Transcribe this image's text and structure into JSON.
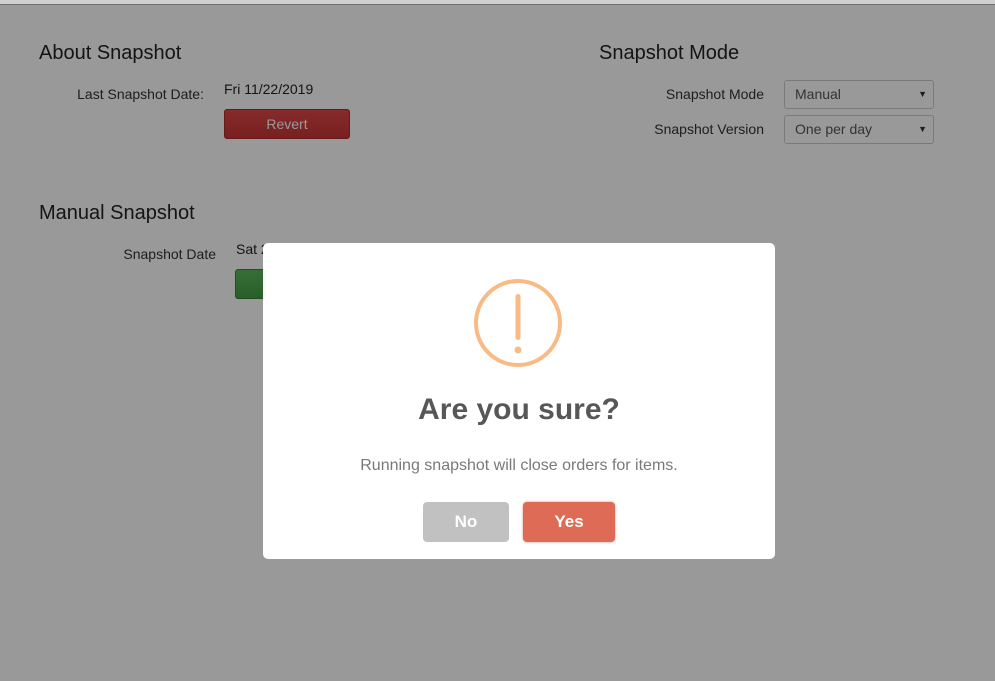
{
  "about": {
    "title": "About Snapshot",
    "last_date_label": "Last Snapshot Date:",
    "last_date_value": "Fri 11/22/2019",
    "revert_label": "Revert"
  },
  "mode": {
    "title": "Snapshot Mode",
    "mode_label": "Snapshot Mode",
    "mode_value": "Manual",
    "version_label": "Snapshot Version",
    "version_value": "One per day"
  },
  "manual": {
    "title": "Manual Snapshot",
    "date_label": "Snapshot Date",
    "date_value_visible": "Sat 2"
  },
  "dialog": {
    "icon": "warning-exclamation-icon",
    "icon_color": "#f8bb86",
    "title": "Are you sure?",
    "text": "Running snapshot will close orders for items.",
    "no_label": "No",
    "yes_label": "Yes",
    "yes_color": "#dd6b55",
    "no_color": "#c1c1c1"
  }
}
